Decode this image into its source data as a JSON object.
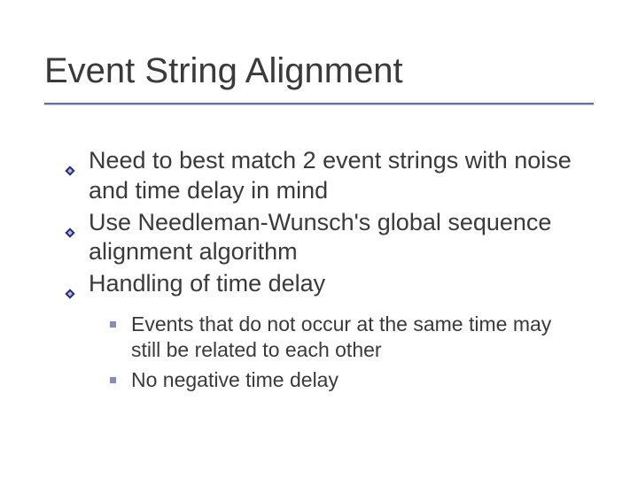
{
  "slide": {
    "title": "Event String Alignment",
    "bullets": [
      {
        "text": "Need to best match 2 event strings with noise and time delay in mind"
      },
      {
        "text": "Use Needleman-Wunsch's global sequence alignment algorithm"
      },
      {
        "text": "Handling of time delay",
        "sub": [
          "Events that do not occur at the same time may still be related to each other",
          "No negative time delay"
        ]
      }
    ]
  }
}
